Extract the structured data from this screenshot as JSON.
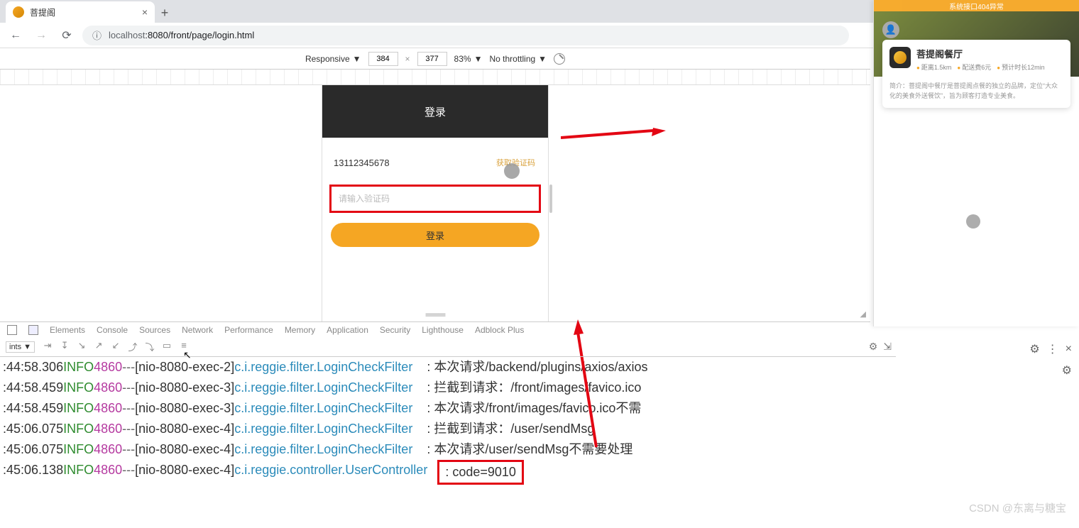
{
  "browser": {
    "tab_title": "菩提阁",
    "url_host": "localhost",
    "url_port_path": ":8080/front/page/login.html"
  },
  "devtools": {
    "device_mode": "Responsive",
    "width": "384",
    "height": "377",
    "zoom": "83%",
    "throttling": "No throttling",
    "tabs": [
      "Elements",
      "Console",
      "Sources",
      "Network",
      "Performance",
      "Memory",
      "Application",
      "Security",
      "Lighthouse",
      "Adblock Plus"
    ],
    "subpanel_select": "ints ▼"
  },
  "login": {
    "header": "登录",
    "phone_value": "13112345678",
    "get_code_label": "获取验证码",
    "code_placeholder": "请输入验证码",
    "submit_label": "登录"
  },
  "right_panel": {
    "banner": "系统接口404异常",
    "title": "菩提阁餐厅",
    "meta_distance": "距离1.5km",
    "meta_delivery": "配送费6元",
    "meta_eta": "预计时长12min",
    "desc": "简介：菩提阁中餐厅是菩提阁点餐的独立的品牌，定位“大众化的美食外送餐饮”，旨为顾客打造专业美食。"
  },
  "logs": [
    {
      "ts": ":44:58.306",
      "lvl": "INFO",
      "pid": "4860",
      "thr": "[nio-8080-exec-2]",
      "cls": "c.i.reggie.filter.LoginCheckFilter",
      "msg": ": 本次请求/backend/plugins/axios/axios"
    },
    {
      "ts": ":44:58.459",
      "lvl": "INFO",
      "pid": "4860",
      "thr": "[nio-8080-exec-3]",
      "cls": "c.i.reggie.filter.LoginCheckFilter",
      "msg": ": 拦截到请求：/front/images/favico.ico"
    },
    {
      "ts": ":44:58.459",
      "lvl": "INFO",
      "pid": "4860",
      "thr": "[nio-8080-exec-3]",
      "cls": "c.i.reggie.filter.LoginCheckFilter",
      "msg": ": 本次请求/front/images/favico.ico不需"
    },
    {
      "ts": ":45:06.075",
      "lvl": "INFO",
      "pid": "4860",
      "thr": "[nio-8080-exec-4]",
      "cls": "c.i.reggie.filter.LoginCheckFilter",
      "msg": ": 拦截到请求：/user/sendMsg"
    },
    {
      "ts": ":45:06.075",
      "lvl": "INFO",
      "pid": "4860",
      "thr": "[nio-8080-exec-4]",
      "cls": "c.i.reggie.filter.LoginCheckFilter",
      "msg": ": 本次请求/user/sendMsg不需要处理"
    },
    {
      "ts": ":45:06.138",
      "lvl": "INFO",
      "pid": "4860",
      "thr": "[nio-8080-exec-4]",
      "cls": "c.i.reggie.controller.UserController",
      "msg_prefix": "",
      "code_box": ": code=9010"
    }
  ],
  "watermark": "CSDN @东离与糖宝"
}
